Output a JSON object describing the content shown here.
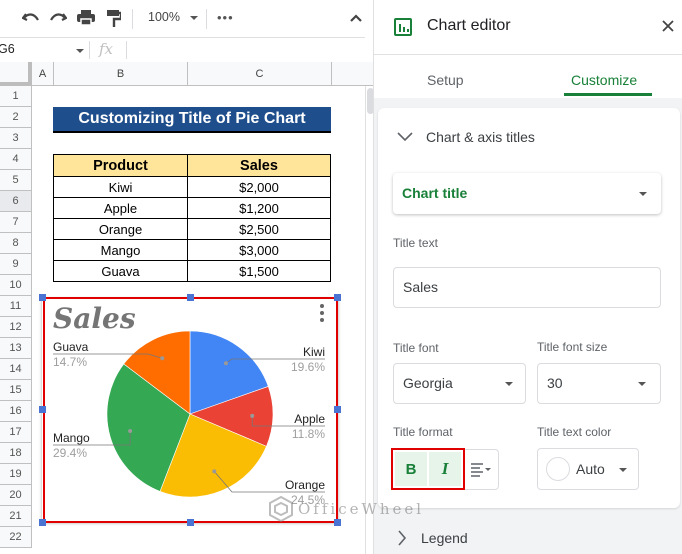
{
  "toolbar": {
    "undo_icon": "undo-icon",
    "redo_icon": "redo-icon",
    "print_icon": "print-icon",
    "paint_format_icon": "paint-format-icon",
    "zoom": "100%",
    "more_icon": "more-horizontal-icon",
    "collapse_icon": "chevron-up-icon"
  },
  "formula_bar": {
    "name_box": "G6",
    "fx_label": "fx",
    "value": ""
  },
  "columns": [
    "A",
    "B",
    "C"
  ],
  "rows": [
    "1",
    "2",
    "3",
    "4",
    "5",
    "6",
    "7",
    "8",
    "9",
    "10",
    "11",
    "12",
    "13",
    "14",
    "15",
    "16",
    "17",
    "18",
    "19",
    "20",
    "21",
    "22"
  ],
  "selected_row": "6",
  "sheet": {
    "title": "Customizing Title of Pie Chart",
    "table": {
      "headers": [
        "Product",
        "Sales"
      ],
      "rows": [
        [
          "Kiwi",
          "$2,000"
        ],
        [
          "Apple",
          "$1,200"
        ],
        [
          "Orange",
          "$2,500"
        ],
        [
          "Mango",
          "$3,000"
        ],
        [
          "Guava",
          "$1,500"
        ]
      ]
    }
  },
  "chart_data": {
    "type": "pie",
    "title": "Sales",
    "categories": [
      "Kiwi",
      "Apple",
      "Orange",
      "Mango",
      "Guava"
    ],
    "values": [
      2000,
      1200,
      2500,
      3000,
      1500
    ],
    "percent_labels": [
      "19.6%",
      "11.8%",
      "24.5%",
      "29.4%",
      "14.7%"
    ],
    "colors": [
      "#4285f4",
      "#ea4335",
      "#fbbc04",
      "#34a853",
      "#ff6d01"
    ],
    "start_angle_deg": 0,
    "direction": "clockwise",
    "legend": "labeled"
  },
  "watermark": "OfficeWheel",
  "editor": {
    "title": "Chart editor",
    "close_icon": "close-icon",
    "tabs": [
      {
        "label": "Setup",
        "active": false
      },
      {
        "label": "Customize",
        "active": true
      }
    ],
    "section": "Chart & axis titles",
    "title_type": "Chart title",
    "title_text_label": "Title text",
    "title_text_value": "Sales",
    "title_font_label": "Title font",
    "title_font_value": "Georgia",
    "title_font_size_label": "Title font size",
    "title_font_size_value": "30",
    "title_format_label": "Title format",
    "bold_label": "B",
    "italic_label": "I",
    "bold_active": true,
    "italic_active": true,
    "title_color_label": "Title text color",
    "title_color_value": "Auto",
    "next_section": "Legend",
    "accent_color": "#188038"
  }
}
